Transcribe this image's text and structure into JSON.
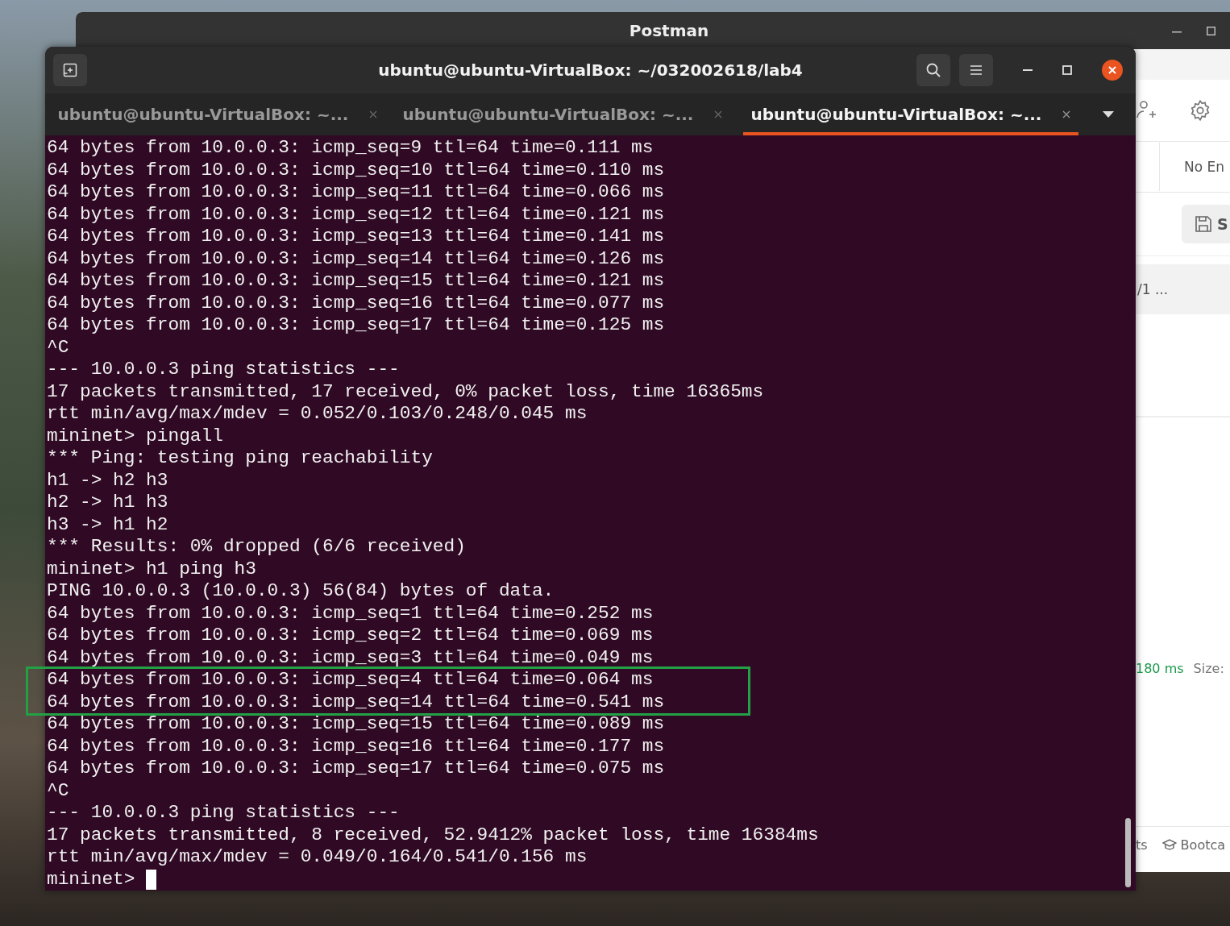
{
  "postman": {
    "title": "Postman",
    "environment": "No En",
    "save_label": "S",
    "request_tab": "/1 ...",
    "response_time": "180 ms",
    "size_label": "Size:",
    "footer_items": [
      {
        "kind": "text",
        "label": "ts"
      },
      {
        "kind": "bootcamp",
        "label": "Bootca"
      }
    ]
  },
  "terminal": {
    "title": "ubuntu@ubuntu-VirtualBox: ~/032002618/lab4",
    "tabs": [
      {
        "label": "ubuntu@ubuntu-VirtualBox: ~...",
        "selected": false
      },
      {
        "label": "ubuntu@ubuntu-VirtualBox: ~...",
        "selected": false
      },
      {
        "label": "ubuntu@ubuntu-VirtualBox: ~...",
        "selected": true
      }
    ],
    "lines": [
      {
        "text": "64 bytes from 10.0.0.3: icmp_seq=9 ttl=64 time=0.111 ms",
        "highlighted": false
      },
      {
        "text": "64 bytes from 10.0.0.3: icmp_seq=10 ttl=64 time=0.110 ms",
        "highlighted": false
      },
      {
        "text": "64 bytes from 10.0.0.3: icmp_seq=11 ttl=64 time=0.066 ms",
        "highlighted": false
      },
      {
        "text": "64 bytes from 10.0.0.3: icmp_seq=12 ttl=64 time=0.121 ms",
        "highlighted": false
      },
      {
        "text": "64 bytes from 10.0.0.3: icmp_seq=13 ttl=64 time=0.141 ms",
        "highlighted": false
      },
      {
        "text": "64 bytes from 10.0.0.3: icmp_seq=14 ttl=64 time=0.126 ms",
        "highlighted": false
      },
      {
        "text": "64 bytes from 10.0.0.3: icmp_seq=15 ttl=64 time=0.121 ms",
        "highlighted": false
      },
      {
        "text": "64 bytes from 10.0.0.3: icmp_seq=16 ttl=64 time=0.077 ms",
        "highlighted": false
      },
      {
        "text": "64 bytes from 10.0.0.3: icmp_seq=17 ttl=64 time=0.125 ms",
        "highlighted": false
      },
      {
        "text": "^C",
        "highlighted": false
      },
      {
        "text": "--- 10.0.0.3 ping statistics ---",
        "highlighted": false
      },
      {
        "text": "17 packets transmitted, 17 received, 0% packet loss, time 16365ms",
        "highlighted": false
      },
      {
        "text": "rtt min/avg/max/mdev = 0.052/0.103/0.248/0.045 ms",
        "highlighted": false
      },
      {
        "text": "mininet> pingall",
        "highlighted": false
      },
      {
        "text": "*** Ping: testing ping reachability",
        "highlighted": false
      },
      {
        "text": "h1 -> h2 h3",
        "highlighted": false
      },
      {
        "text": "h2 -> h1 h3",
        "highlighted": false
      },
      {
        "text": "h3 -> h1 h2",
        "highlighted": false
      },
      {
        "text": "*** Results: 0% dropped (6/6 received)",
        "highlighted": false
      },
      {
        "text": "mininet> h1 ping h3",
        "highlighted": false
      },
      {
        "text": "PING 10.0.0.3 (10.0.0.3) 56(84) bytes of data.",
        "highlighted": false
      },
      {
        "text": "64 bytes from 10.0.0.3: icmp_seq=1 ttl=64 time=0.252 ms",
        "highlighted": false
      },
      {
        "text": "64 bytes from 10.0.0.3: icmp_seq=2 ttl=64 time=0.069 ms",
        "highlighted": false
      },
      {
        "text": "64 bytes from 10.0.0.3: icmp_seq=3 ttl=64 time=0.049 ms",
        "highlighted": false
      },
      {
        "text": "64 bytes from 10.0.0.3: icmp_seq=4 ttl=64 time=0.064 ms",
        "highlighted": true
      },
      {
        "text": "64 bytes from 10.0.0.3: icmp_seq=14 ttl=64 time=0.541 ms",
        "highlighted": true
      },
      {
        "text": "64 bytes from 10.0.0.3: icmp_seq=15 ttl=64 time=0.089 ms",
        "highlighted": false
      },
      {
        "text": "64 bytes from 10.0.0.3: icmp_seq=16 ttl=64 time=0.177 ms",
        "highlighted": false
      },
      {
        "text": "64 bytes from 10.0.0.3: icmp_seq=17 ttl=64 time=0.075 ms",
        "highlighted": false
      },
      {
        "text": "^C",
        "highlighted": false
      },
      {
        "text": "--- 10.0.0.3 ping statistics ---",
        "highlighted": false
      },
      {
        "text": "17 packets transmitted, 8 received, 52.9412% packet loss, time 16384ms",
        "highlighted": false
      },
      {
        "text": "rtt min/avg/max/mdev = 0.049/0.164/0.541/0.156 ms",
        "highlighted": false
      }
    ],
    "prompt": {
      "text": "mininet>",
      "cursor": true
    }
  }
}
